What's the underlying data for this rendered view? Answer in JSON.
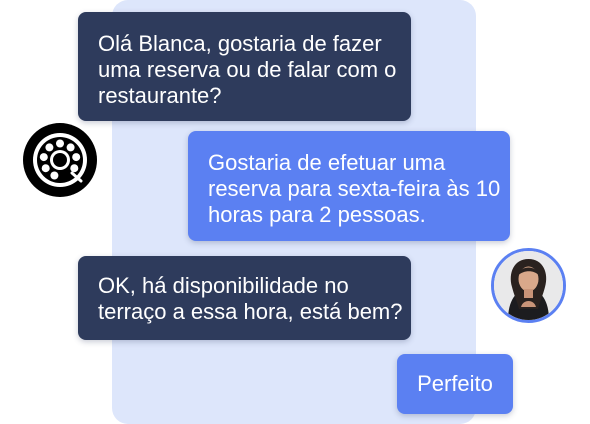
{
  "conversation": {
    "messages": [
      {
        "from": "bot",
        "lines": [
          "Olá Blanca, gostaria de fazer",
          "uma reserva ou de falar com o",
          "restaurante?"
        ]
      },
      {
        "from": "user",
        "lines": [
          "Gostaria de efetuar uma",
          "reserva para sexta-feira às 10",
          "horas para 2 pessoas."
        ]
      },
      {
        "from": "bot",
        "lines": [
          "OK, há disponibilidade no",
          "terraço a essa hora, está bem?"
        ]
      },
      {
        "from": "user",
        "lines": [
          "Perfeito"
        ]
      }
    ]
  },
  "icons": {
    "bot": "rotary-phone-icon",
    "user": "user-avatar"
  },
  "colors": {
    "panel_background": "#dde6fb",
    "bot_bubble": "#2e3b5c",
    "user_bubble": "#5b80f2",
    "text": "#ffffff",
    "avatar_ring": "#5b80f2"
  }
}
